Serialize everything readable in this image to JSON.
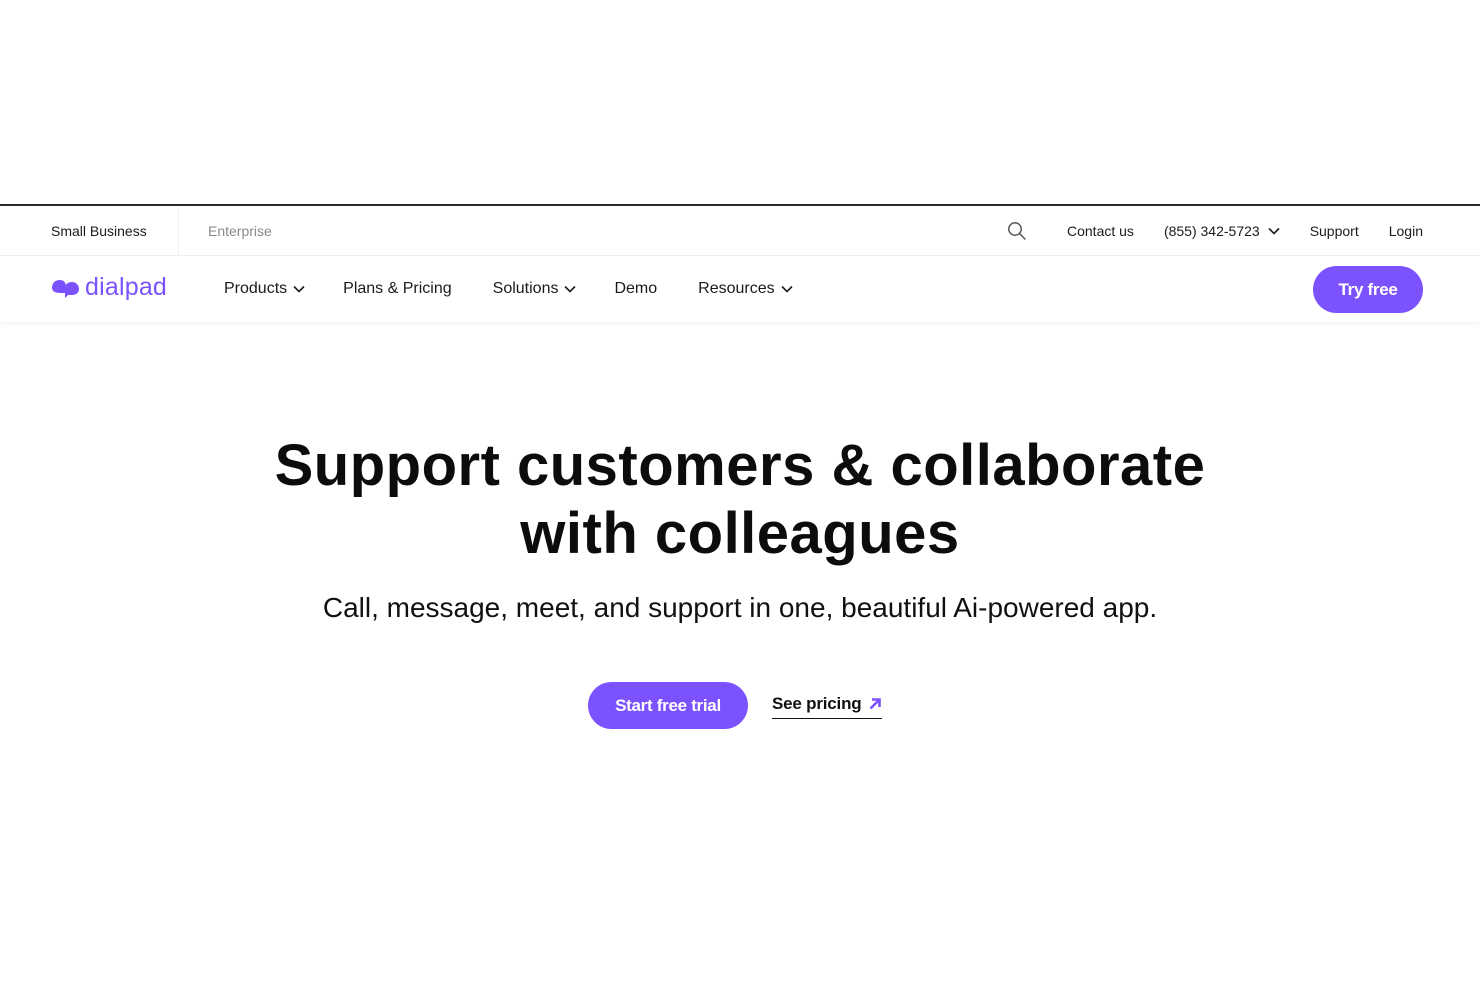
{
  "utility_bar": {
    "segments": [
      {
        "label": "Small Business",
        "active": true
      },
      {
        "label": "Enterprise",
        "active": false
      }
    ],
    "search_icon": "search-icon",
    "contact_label": "Contact us",
    "phone_label": "(855) 342-5723",
    "support_label": "Support",
    "login_label": "Login"
  },
  "main_nav": {
    "logo_text": "dialpad",
    "items": [
      {
        "label": "Products",
        "has_dropdown": true
      },
      {
        "label": "Plans & Pricing",
        "has_dropdown": false
      },
      {
        "label": "Solutions",
        "has_dropdown": true
      },
      {
        "label": "Demo",
        "has_dropdown": false
      },
      {
        "label": "Resources",
        "has_dropdown": true
      }
    ],
    "cta_label": "Try free"
  },
  "hero": {
    "title_line1": "Support customers & collaborate",
    "title_line2": "with colleagues",
    "subtitle": "Call, message, meet, and support in one, beautiful Ai-powered app.",
    "primary_cta": "Start free trial",
    "secondary_cta": "See pricing"
  },
  "colors": {
    "brand": "#7c52ff",
    "text": "#111111",
    "muted": "#8a8a8a"
  }
}
